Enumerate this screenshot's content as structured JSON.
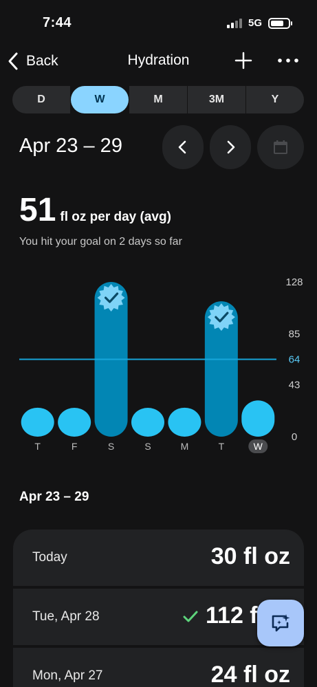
{
  "status_bar": {
    "time": "7:44",
    "network": "5G"
  },
  "nav": {
    "back_label": "Back",
    "title": "Hydration"
  },
  "range_tabs": [
    {
      "label": "D",
      "active": false
    },
    {
      "label": "W",
      "active": true
    },
    {
      "label": "M",
      "active": false
    },
    {
      "label": "3M",
      "active": false
    },
    {
      "label": "Y",
      "active": false
    }
  ],
  "date_range": "Apr 23 – 29",
  "summary": {
    "value": "51",
    "unit": "fl oz per day (avg)",
    "goal_text": "You hit your goal on 2 days so far"
  },
  "chart_data": {
    "type": "bar",
    "categories": [
      "T",
      "F",
      "S",
      "S",
      "M",
      "T",
      "W"
    ],
    "values": [
      24,
      19,
      128,
      19,
      24,
      112,
      30
    ],
    "goal_met": [
      false,
      false,
      true,
      false,
      false,
      true,
      false
    ],
    "current_index": 6,
    "yticks": [
      "0",
      "43",
      "64",
      "85",
      "128"
    ],
    "ylim": [
      0,
      128
    ],
    "goal_line": 64,
    "colors": {
      "bar_light": "#29c3f3",
      "bar_dark": "#0286b4",
      "goal_line": "#17a6da",
      "goal_label": "#59c9f5",
      "badge": "#7fd3f7"
    }
  },
  "list": {
    "heading": "Apr 23 – 29",
    "rows": [
      {
        "label": "Today",
        "value": "30 fl oz"
      },
      {
        "label": "Tue, Apr 28",
        "value": "112 fl oz"
      },
      {
        "label": "Mon, Apr 27",
        "value": "24 fl oz"
      }
    ]
  },
  "icons": {
    "back": "chevron-left-icon",
    "add": "plus-icon",
    "more": "more-horiz-icon",
    "prev": "chevron-left-icon",
    "next": "chevron-right-icon",
    "calendar": "calendar-icon",
    "goal_badge": "verified-check-icon",
    "check": "check-icon",
    "fab": "ai-chat-sparkle-icon"
  }
}
